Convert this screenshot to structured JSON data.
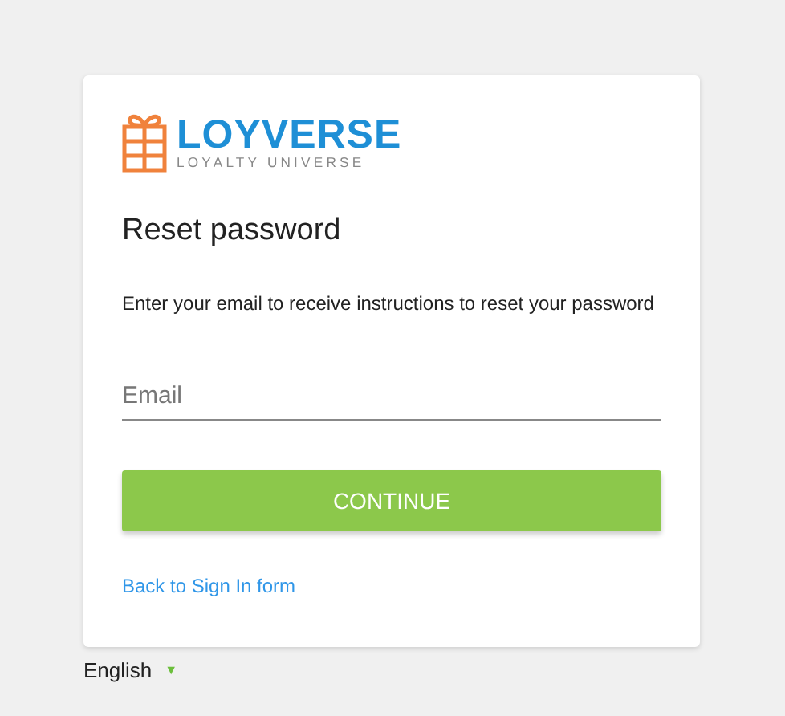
{
  "logo": {
    "name": "LOYVERSE",
    "tagline": "LOYALTY UNIVERSE"
  },
  "title": "Reset password",
  "description": "Enter your email to receive instructions to reset your password",
  "email_field": {
    "placeholder": "Email"
  },
  "button": "CONTINUE",
  "link": "Back to Sign In form",
  "language": {
    "label": "English",
    "caret": "▼"
  }
}
